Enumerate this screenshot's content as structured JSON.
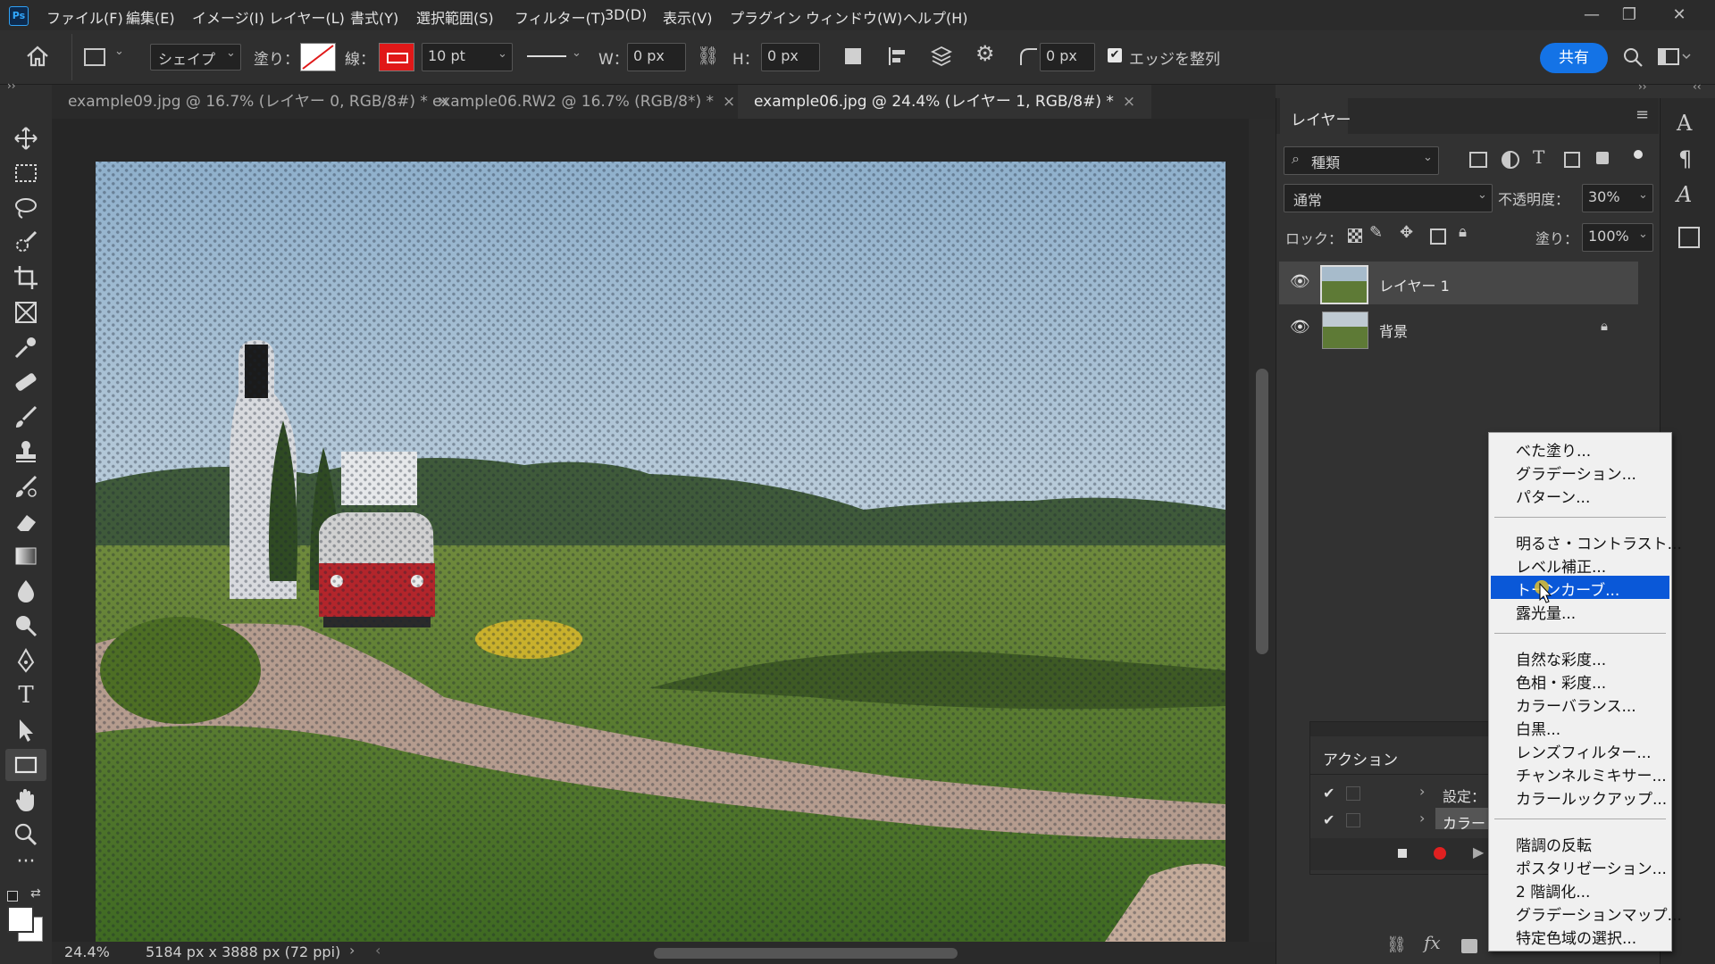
{
  "menubar": {
    "logo": "Ps",
    "items": [
      "ファイル(F)",
      "編集(E)",
      "イメージ(I)",
      "レイヤー(L)",
      "書式(Y)",
      "選択範囲(S)",
      "フィルター(T)",
      "3D(D)",
      "表示(V)",
      "プラグイン",
      "ウィンドウ(W)",
      "ヘルプ(H)"
    ]
  },
  "options": {
    "shape_mode": "シェイプ",
    "fill_label": "塗り：",
    "stroke_label": "線：",
    "stroke_width": "10 pt",
    "w_label": "W：",
    "w_value": "0 px",
    "h_label": "H：",
    "h_value": "0 px",
    "radius_value": "0 px",
    "align_edges": "エッジを整列",
    "share": "共有",
    "stroke_color": "#e01818"
  },
  "tabs": [
    {
      "label": "example09.jpg @ 16.7% (レイヤー 0, RGB/8#) *",
      "close": "×"
    },
    {
      "label": "example06.RW2 @ 16.7% (RGB/8*) *",
      "close": "×"
    },
    {
      "label": "example06.jpg @ 24.4% (レイヤー 1, RGB/8#) *",
      "close": "×"
    }
  ],
  "status": {
    "zoom": "24.4%",
    "dimensions": "5184 px x 3888 px (72 ppi)"
  },
  "layers_panel": {
    "title": "レイヤー",
    "filter": "種類",
    "blend_mode": "通常",
    "opacity_label": "不透明度：",
    "opacity_value": "30%",
    "lock_label": "ロック：",
    "fill_label": "塗り：",
    "fill_value": "100%",
    "layers": [
      {
        "name": "レイヤー 1"
      },
      {
        "name": "背景"
      }
    ]
  },
  "actions_panel": {
    "title": "アクション",
    "rows": [
      "設定：",
      "カラー"
    ]
  },
  "adjustment_menu": {
    "groups": [
      [
        "べた塗り...",
        "グラデーション...",
        "パターン..."
      ],
      [
        "明るさ・コントラスト...",
        "レベル補正...",
        "トーンカーブ...",
        "露光量..."
      ],
      [
        "自然な彩度...",
        "色相・彩度...",
        "カラーバランス...",
        "白黒...",
        "レンズフィルター...",
        "チャンネルミキサー...",
        "カラールックアップ..."
      ],
      [
        "階調の反転",
        "ポスタリゼーション...",
        "2 階調化...",
        "グラデーションマップ...",
        "特定色域の選択..."
      ]
    ],
    "highlighted": "トーンカーブ..."
  },
  "colors": {
    "accent": "#1473e6",
    "highlight": "#0a58d8",
    "record": "#e02020"
  }
}
